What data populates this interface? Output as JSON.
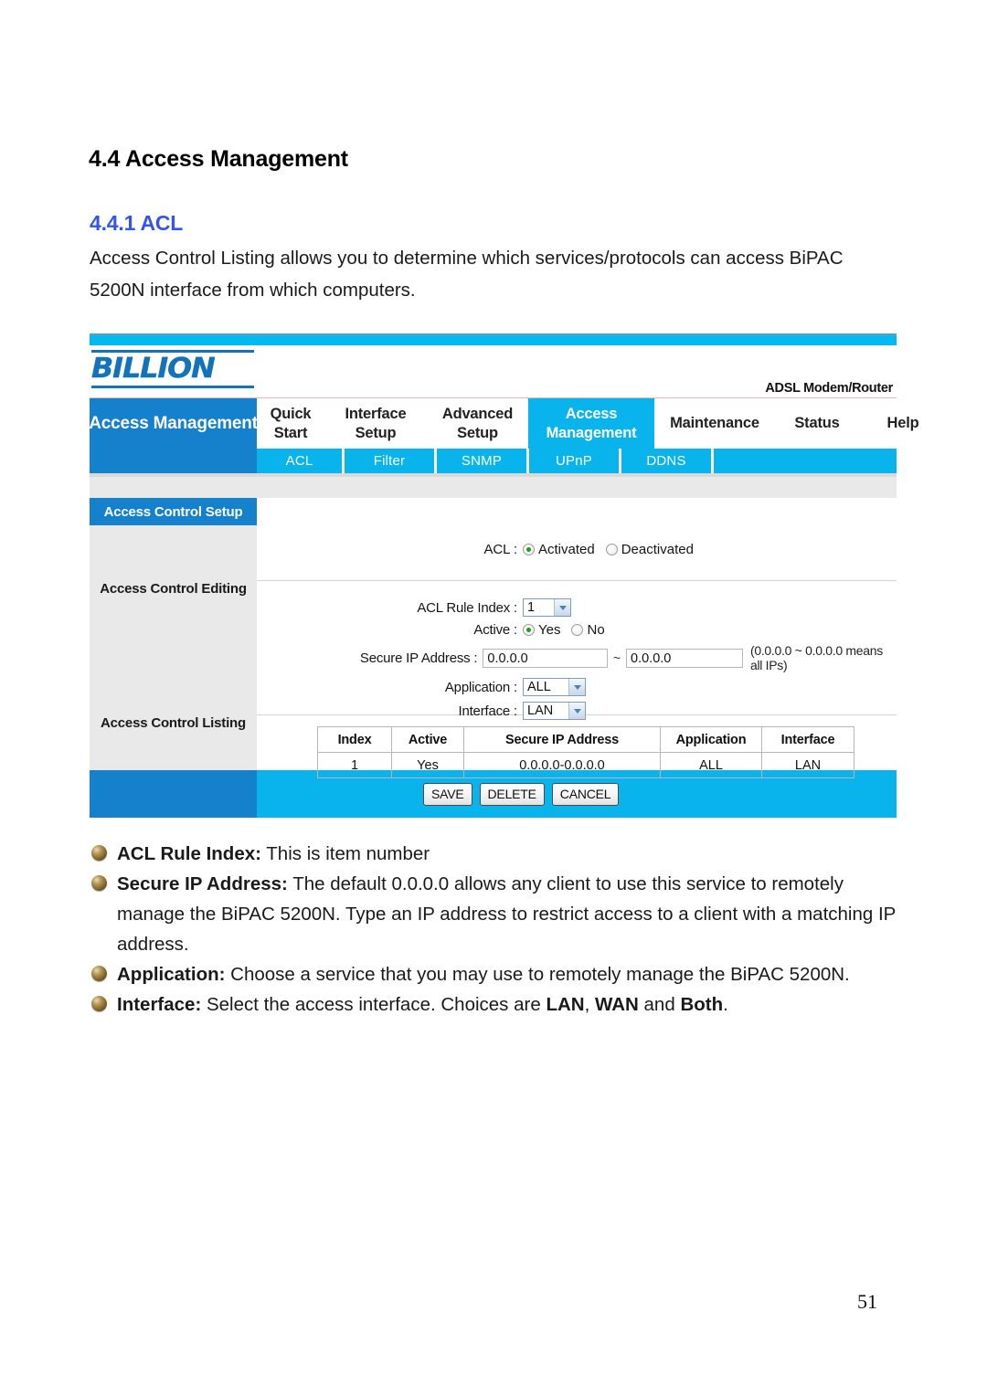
{
  "document": {
    "section_heading": "4.4 Access Management",
    "sub_heading": "4.4.1 ACL",
    "intro_paragraph": "Access Control Listing allows you to determine which services/protocols can access BiPAC 5200N interface from which computers.",
    "page_number": "51",
    "accent_heading_color": "#3355ee"
  },
  "router_ui": {
    "brand": "BILLION",
    "model_label": "ADSL Modem/Router",
    "active_section_title": "Access Management",
    "colors": {
      "brand_blue": "#1581cd",
      "cyan": "#09b4ec",
      "panel_gray": "#e9e9e9"
    },
    "nav": {
      "items": [
        {
          "label": "Quick\nStart",
          "line1": "Quick",
          "line2": "Start",
          "active": false
        },
        {
          "label": "Interface Setup",
          "line1": "Interface",
          "line2": "Setup",
          "active": false
        },
        {
          "label": "Advanced Setup",
          "line1": "Advanced",
          "line2": "Setup",
          "active": false
        },
        {
          "label": "Access Management",
          "line1": "Access",
          "line2": "Management",
          "active": true
        },
        {
          "label": "Maintenance",
          "line1": "Maintenance",
          "line2": "",
          "active": false
        },
        {
          "label": "Status",
          "line1": "Status",
          "line2": "",
          "active": false
        },
        {
          "label": "Help",
          "line1": "Help",
          "line2": "",
          "active": false
        }
      ]
    },
    "subnav": {
      "items": [
        {
          "label": "ACL",
          "active": true
        },
        {
          "label": "Filter",
          "active": false
        },
        {
          "label": "SNMP",
          "active": false
        },
        {
          "label": "UPnP",
          "active": false
        },
        {
          "label": "DDNS",
          "active": false
        }
      ]
    },
    "sidebar": {
      "header": "Access Control Setup",
      "editing_label": "Access Control Editing",
      "listing_label": "Access Control Listing"
    },
    "form": {
      "acl_label": "ACL :",
      "acl_activated": "Activated",
      "acl_deactivated": "Deactivated",
      "acl_selected": "Activated",
      "rule_index_label": "ACL Rule Index :",
      "rule_index_value": "1",
      "active_label": "Active :",
      "active_yes": "Yes",
      "active_no": "No",
      "active_selected": "Yes",
      "secure_ip_label": "Secure IP Address :",
      "secure_ip_start": "0.0.0.0",
      "secure_ip_end": "0.0.0.0",
      "secure_ip_separator": "~",
      "secure_ip_hint": "(0.0.0.0 ~ 0.0.0.0 means all IPs)",
      "application_label": "Application :",
      "application_value": "ALL",
      "interface_label": "Interface :",
      "interface_value": "LAN"
    },
    "table": {
      "headers": [
        "Index",
        "Active",
        "Secure IP Address",
        "Application",
        "Interface"
      ],
      "rows": [
        [
          "1",
          "Yes",
          "0.0.0.0-0.0.0.0",
          "ALL",
          "LAN"
        ]
      ]
    },
    "buttons": {
      "save": "SAVE",
      "delete": "DELETE",
      "cancel": "CANCEL"
    }
  },
  "bullets": [
    {
      "term": "ACL Rule Index:",
      "text": " This is item number"
    },
    {
      "term": "Secure IP Address:",
      "text": " The default 0.0.0.0 allows any client to use this service to remotely manage the BiPAC 5200N. Type an IP address to restrict access to a client with a matching IP address."
    },
    {
      "term": "Application:",
      "text": " Choose a service that you may use to remotely manage the BiPAC 5200N."
    },
    {
      "term": "Interface:",
      "text_before": " Select the access interface. Choices are ",
      "opt1": "LAN",
      "sep1": ", ",
      "opt2": "WAN",
      "sep2": " and ",
      "opt3": "Both",
      "text_after": "."
    }
  ]
}
